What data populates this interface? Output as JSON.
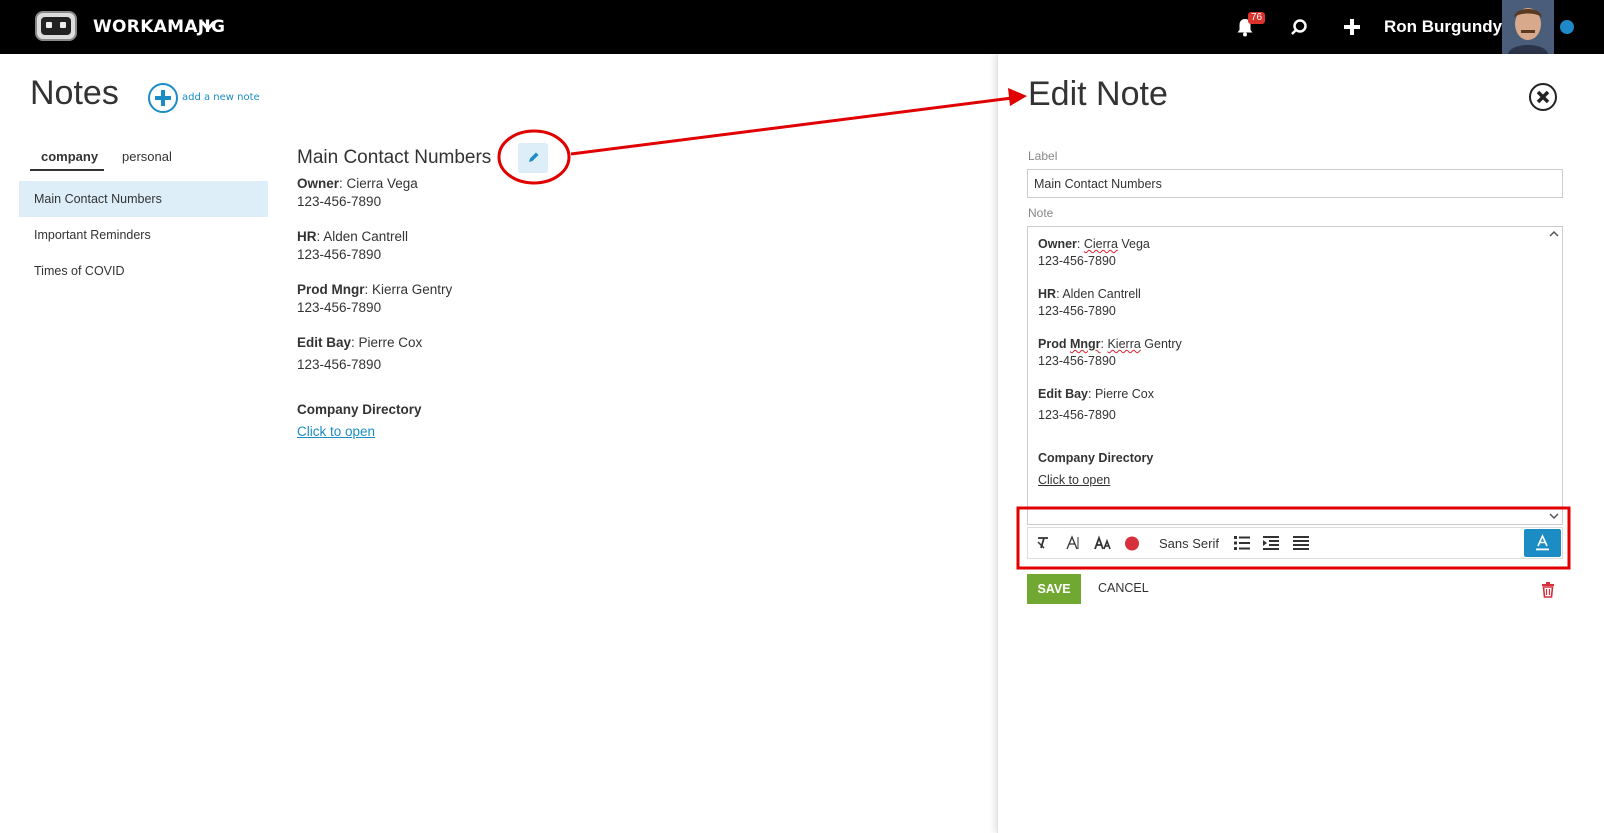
{
  "header": {
    "brand": "WORKAMAJIG",
    "notification_count": "76",
    "user_name": "Ron Burgundy"
  },
  "page": {
    "title": "Notes",
    "add_label": "add a new note"
  },
  "tabs": [
    {
      "label": "company",
      "active": true
    },
    {
      "label": "personal",
      "active": false
    }
  ],
  "notes_list": [
    {
      "label": "Main Contact Numbers",
      "active": true
    },
    {
      "label": "Important Reminders",
      "active": false
    },
    {
      "label": "Times of COVID",
      "active": false
    }
  ],
  "note_view": {
    "title": "Main Contact Numbers",
    "entries": [
      {
        "role": "Owner",
        "name": ": Cierra Vega",
        "phone": "123-456-7890"
      },
      {
        "role": "HR",
        "name": ": Alden Cantrell",
        "phone": "123-456-7890"
      },
      {
        "role": "Prod Mngr",
        "name": ": Kierra Gentry",
        "phone": "123-456-7890"
      },
      {
        "role": "Edit Bay",
        "name": ": Pierre Cox",
        "phone": "123-456-7890"
      }
    ],
    "directory_label": "Company Directory",
    "directory_link": "Click to open"
  },
  "edit_panel": {
    "title": "Edit Note",
    "label_caption": "Label",
    "label_value": "Main Contact Numbers",
    "note_caption": "Note",
    "font_name": "Sans Serif",
    "save_label": "SAVE",
    "cancel_label": "CANCEL"
  },
  "colors": {
    "accent": "#1b8cc4",
    "save": "#71a832",
    "highlight": "#e00000",
    "selected_row": "#ddeef8"
  }
}
